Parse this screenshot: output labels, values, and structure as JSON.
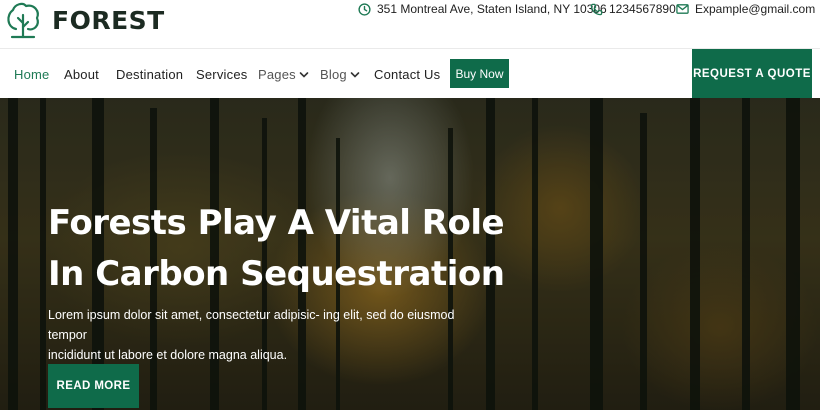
{
  "brand": {
    "name": "FOREST",
    "icon": "tree-icon",
    "color": "#1f7a55"
  },
  "contacts": {
    "address": "351 Montreal Ave, Staten Island, NY 10306",
    "phone": "1234567890",
    "email": "Expample@gmail.com"
  },
  "nav": {
    "home": "Home",
    "about": "About",
    "destination": "Destination",
    "services": "Services",
    "pages": "Pages",
    "blog": "Blog",
    "contact": "Contact Us",
    "buy_now": "Buy Now",
    "quote": "REQUEST A QUOTE"
  },
  "hero": {
    "title_line1": "Forests Play A Vital Role",
    "title_line2": "In Carbon Sequestration",
    "desc_line1": "Lorem ipsum dolor sit amet, consectetur adipisic- ing elit, sed do eiusmod tempor",
    "desc_line2": "incididunt ut labore et dolore magna aliqua.",
    "cta": "READ MORE"
  },
  "colors": {
    "accent": "#0f6b4a",
    "active_nav": "#1f7a55"
  }
}
